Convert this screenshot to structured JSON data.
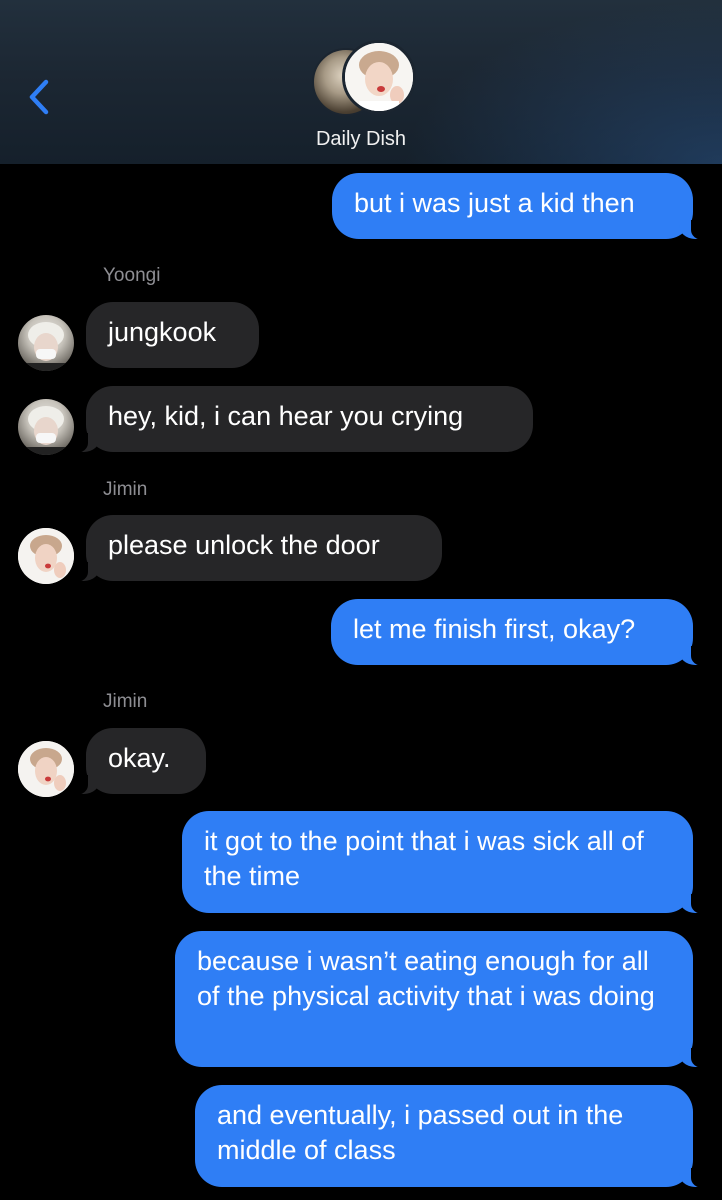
{
  "header": {
    "title": "Daily Dish",
    "back_icon": "chevron-left-icon",
    "accent": "#2f7ef5"
  },
  "messages": [
    {
      "from": "me",
      "text": "but i was just a kid then"
    },
    {
      "sender": "Yoongi",
      "text": "jungkook"
    },
    {
      "sender": "Yoongi",
      "text": "hey, kid, i can hear you crying"
    },
    {
      "sender": "Jimin",
      "text": "please unlock the door"
    },
    {
      "from": "me",
      "text": "let me finish first, okay?"
    },
    {
      "sender": "Jimin",
      "text": "okay."
    },
    {
      "from": "me",
      "text": "it got to the point that i was sick all of the time"
    },
    {
      "from": "me",
      "text": "because i wasn’t eating enough for all of the physical activity that i was doing"
    },
    {
      "from": "me",
      "text": "and eventually, i passed out in the middle of class"
    }
  ],
  "colors": {
    "outgoing_bubble": "#2f7ef5",
    "incoming_bubble": "#262628",
    "background": "#000000"
  }
}
